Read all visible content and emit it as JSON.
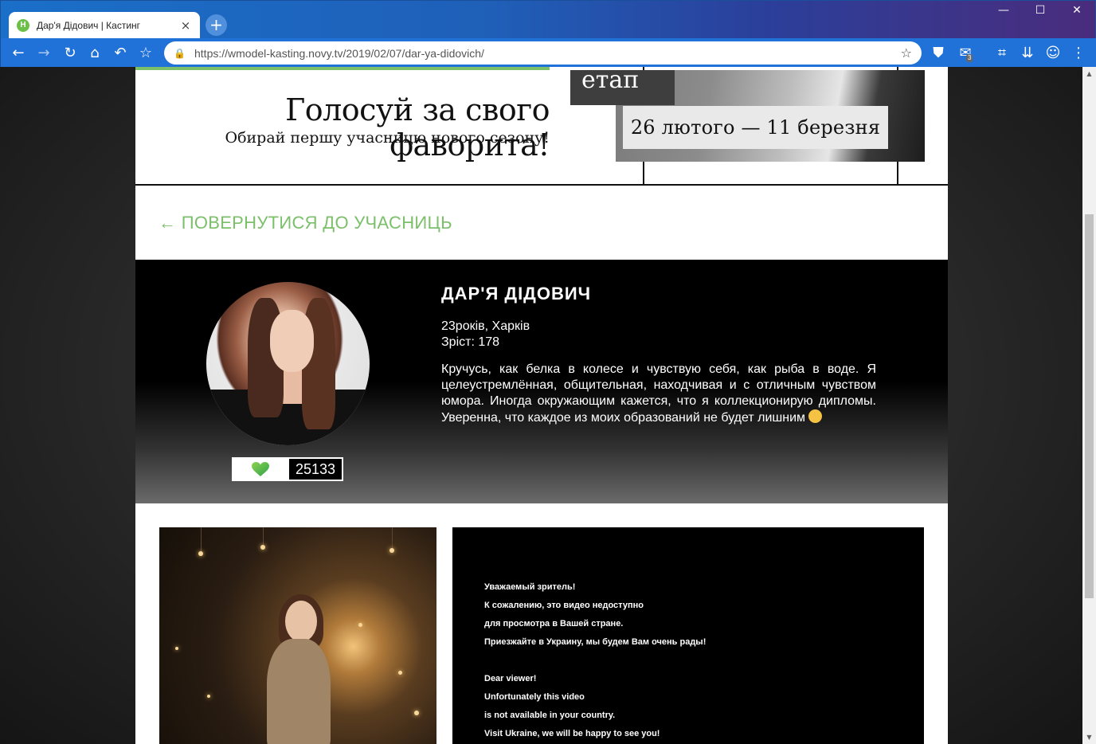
{
  "browser": {
    "tab_favicon": "Н",
    "tab_title": "Дар'я Дідович | Кастинг",
    "tab_close": "×",
    "new_tab": "+",
    "url": "https://wmodel-kasting.novy.tv/2019/02/07/dar-ya-didovich/",
    "minimize": "—",
    "maximize": "☐",
    "close": "✕",
    "mail_badge": "3",
    "icons": [
      "back-icon",
      "forward-icon",
      "reload-icon",
      "home-icon",
      "undo-icon",
      "star-icon",
      "lock-icon",
      "shield-icon",
      "mail-icon",
      "crop-icon",
      "download-icon",
      "avatar-icon",
      "menu-icon"
    ]
  },
  "banner": {
    "stage": "етап",
    "headline": "Голосуй за свого фаворита!",
    "subheadline": "Обирай першу учасницю нового сезону!",
    "dates": "26 лютого — 11 березня"
  },
  "back_link": "← ПОВЕРНУТИСЯ ДО УЧАСНИЦЬ",
  "profile": {
    "name": "ДАР'Я ДІДОВИЧ",
    "age_city": "23років, Харків",
    "height": "Зріст: 178",
    "bio": "Кручусь, как белка в колесе и чувствую себя, как рыба в воде. Я целеустремлённая, общительная, находчивая и с отличным чувством юмора. Иногда окружающим кажется, что я коллекционирую дипломы. Уверенна, что каждое из моих образований не будет лишним",
    "likes": "25133",
    "heart_color": "#5bbf4a"
  },
  "video": {
    "lines": [
      "Уважаемый зритель!",
      "К сожалению, это видео недоступно",
      "для просмотра в Вашей стране.",
      "Приезжайте в Украину, мы будем Вам очень рады!",
      "",
      "Dear viewer!",
      "Unfortunately this video",
      "is not available in your country.",
      "Visit Ukraine, we will be happy to see you!"
    ]
  },
  "colors": {
    "accent_green": "#7cbf6a",
    "chrome_blue": "#2172d8"
  }
}
